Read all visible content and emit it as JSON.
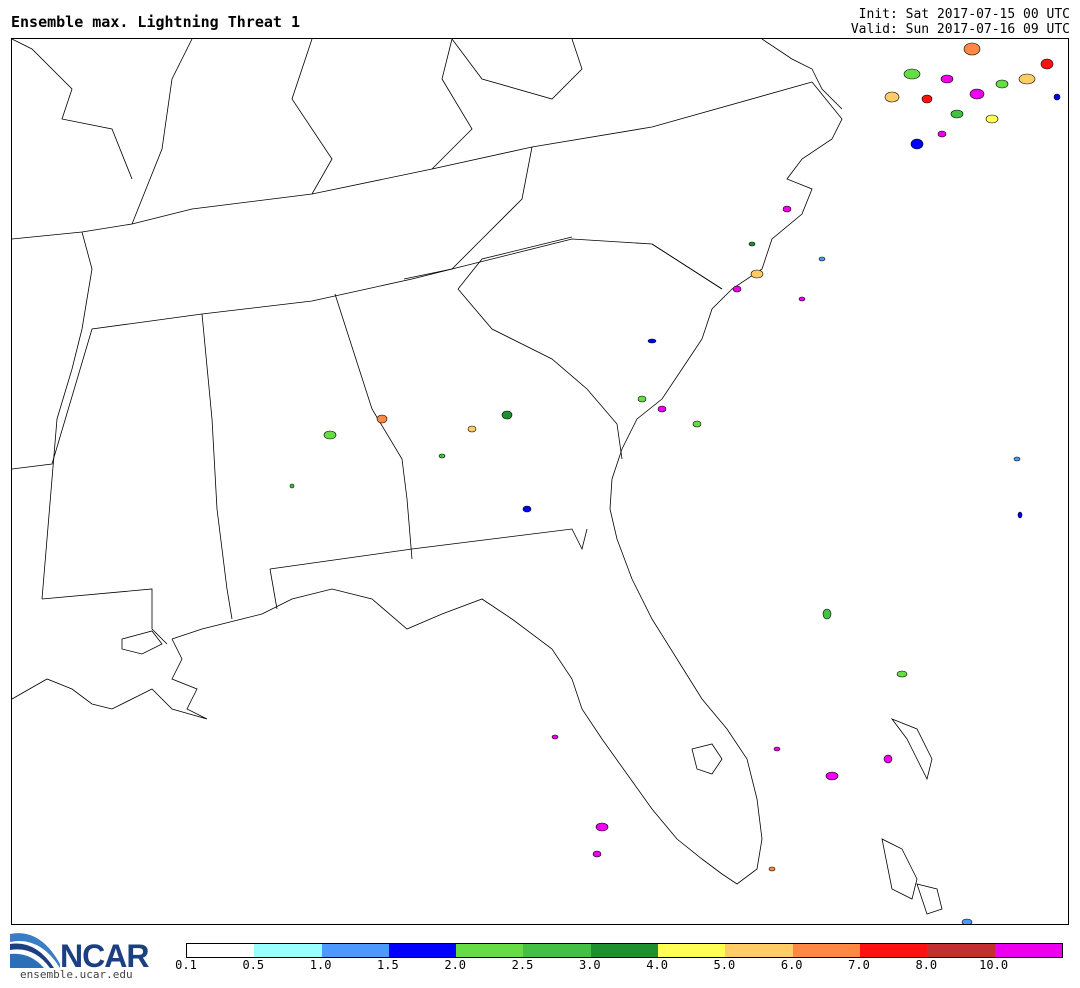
{
  "header": {
    "title": "Ensemble max. Lightning Threat 1",
    "init": "Init: Sat 2017-07-15 00 UTC",
    "valid": "Valid: Sun 2017-07-16 09 UTC"
  },
  "footer": {
    "logo_text": "NCAR",
    "url": "ensemble.ucar.edu"
  },
  "colorbar": {
    "colors": [
      "#ffffff",
      "#99ffff",
      "#4d99ff",
      "#0000ff",
      "#66dd44",
      "#44c044",
      "#1e9030",
      "#ffff55",
      "#ffcc66",
      "#ff8844",
      "#ff1111",
      "#c03030",
      "#ee00ee"
    ],
    "ticks": [
      "0.1",
      "0.5",
      "1.0",
      "1.5",
      "2.0",
      "2.5",
      "3.0",
      "4.0",
      "5.0",
      "6.0",
      "7.0",
      "8.0",
      "10.0"
    ]
  }
}
